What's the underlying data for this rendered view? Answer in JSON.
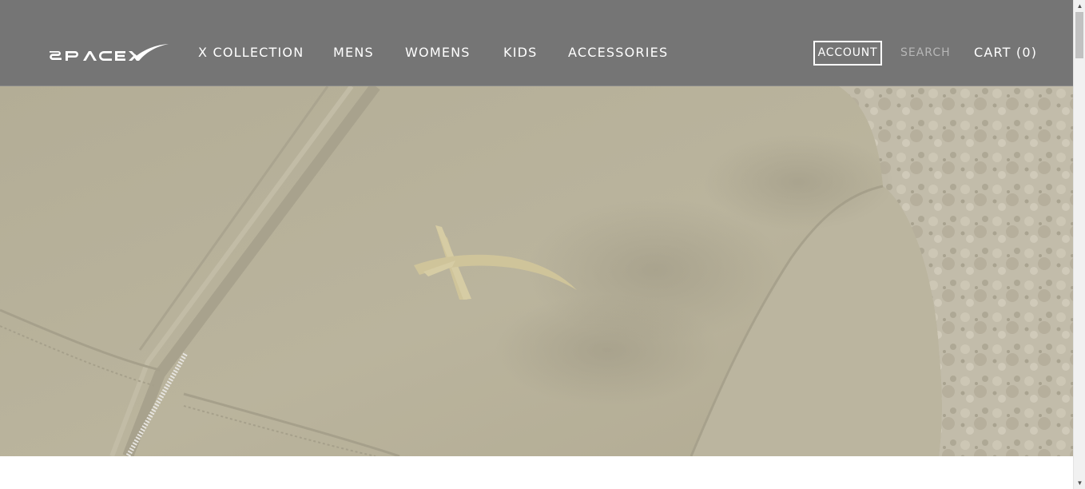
{
  "header": {
    "logo_text": "SPACEX",
    "nav": [
      {
        "label": "X COLLECTION"
      },
      {
        "label": "MENS"
      },
      {
        "label": "WOMENS"
      },
      {
        "label": "KIDS"
      },
      {
        "label": "ACCESSORIES"
      }
    ],
    "account_label": "ACCOUNT",
    "search_placeholder": "SEARCH",
    "cart_label": "CART (0)"
  },
  "hero": {
    "image_name": "hoodie-closeup-with-x-logo"
  },
  "colors": {
    "header_bg": "#757575",
    "header_text": "#ffffff",
    "search_text": "#b7b7b7",
    "hero_fabric": "#b6b09a",
    "hero_logo": "#cfc49a"
  }
}
